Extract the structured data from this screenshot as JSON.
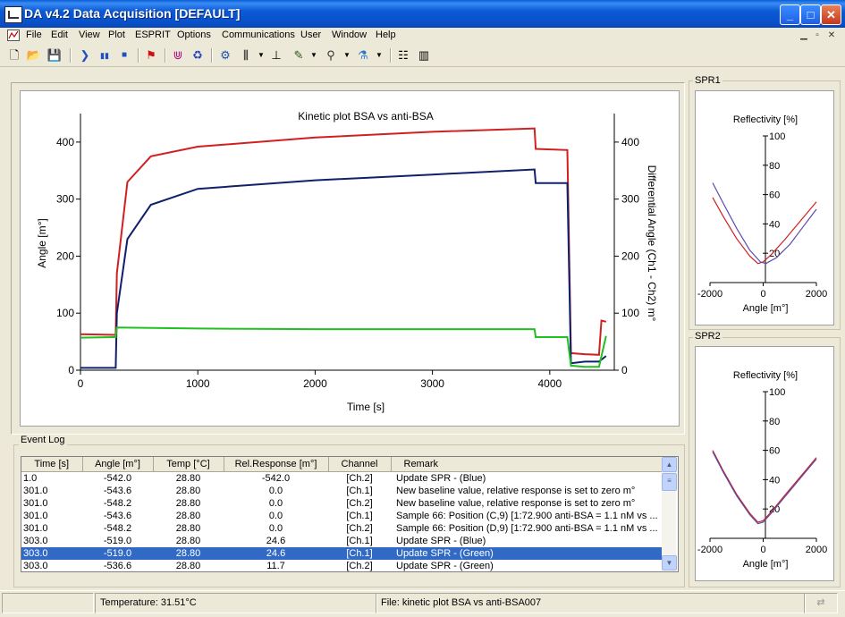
{
  "window": {
    "title": "DA v4.2 Data Acquisition [DEFAULT]",
    "min_label": "_",
    "max_label": "□",
    "close_label": "✕"
  },
  "menu": [
    "File",
    "Edit",
    "View",
    "Plot",
    "ESPRIT",
    "Options",
    "Communications",
    "User",
    "Window",
    "Help"
  ],
  "toolbar_icons": [
    "new-file-icon",
    "open-folder-icon",
    "save-icon",
    "play-icon",
    "pause-icon",
    "stop-icon",
    "flag-icon",
    "spectrum-icon",
    "recycle-icon",
    "settings-icon",
    "tubes-icon",
    "injector-icon",
    "pipette-icon",
    "tap-icon",
    "flask-icon",
    "layout-icon",
    "bars-icon"
  ],
  "main_plot": {
    "title": "Kinetic plot BSA vs anti-BSA",
    "xlabel": "Time [s]",
    "ylabel": "Angle [m°]",
    "y2label": "Differential Angle (Ch1 - Ch2) m°"
  },
  "chart_data": [
    {
      "type": "line",
      "title": "Kinetic plot BSA vs anti-BSA",
      "xlabel": "Time [s]",
      "ylabel": "Angle [m°]",
      "y2label": "Differential Angle (Ch1 - Ch2) m°",
      "xlim": [
        0,
        4550
      ],
      "ylim": [
        0,
        450
      ],
      "y2lim": [
        0,
        450
      ],
      "xticks": [
        0,
        1000,
        2000,
        3000,
        4000
      ],
      "yticks": [
        0,
        100,
        200,
        300,
        400
      ],
      "series": [
        {
          "color": "#d02020",
          "x": [
            0,
            300,
            310,
            400,
            600,
            1000,
            2000,
            3000,
            3870,
            3880,
            4150,
            4180,
            4300,
            4420,
            4440,
            4480
          ],
          "y": [
            63,
            62,
            170,
            330,
            375,
            392,
            408,
            418,
            424,
            388,
            386,
            30,
            28,
            27,
            87,
            85
          ]
        },
        {
          "color": "#10206a",
          "x": [
            0,
            300,
            310,
            400,
            600,
            1000,
            2000,
            3000,
            3870,
            3880,
            4150,
            4180,
            4300,
            4420,
            4480
          ],
          "y": [
            4,
            4,
            100,
            230,
            290,
            318,
            333,
            343,
            352,
            328,
            328,
            12,
            15,
            15,
            25
          ]
        },
        {
          "color": "#20c020",
          "x": [
            0,
            300,
            310,
            1000,
            2000,
            3000,
            3870,
            3880,
            4150,
            4180,
            4300,
            4420,
            4480
          ],
          "y": [
            57,
            58,
            75,
            73,
            72,
            72,
            72,
            58,
            58,
            8,
            6,
            6,
            60
          ]
        }
      ]
    },
    {
      "type": "line",
      "title": "Reflectivity [%]",
      "xlabel": "Angle [m°]",
      "xlim": [
        -2000,
        2000
      ],
      "ylim": [
        0,
        100
      ],
      "xticks": [
        -2000,
        0,
        2000
      ],
      "yticks": [
        20,
        40,
        60,
        80,
        100
      ],
      "series": [
        {
          "color": "#d02020",
          "x": [
            -1900,
            -1500,
            -1000,
            -500,
            -200,
            0,
            300,
            800,
            1400,
            2000
          ],
          "y": [
            58,
            45,
            30,
            18,
            13,
            14,
            19,
            29,
            42,
            55
          ]
        },
        {
          "color": "#5a4ab0",
          "x": [
            -1900,
            -1500,
            -1000,
            -500,
            -100,
            100,
            500,
            1000,
            1500,
            2000
          ],
          "y": [
            68,
            54,
            37,
            22,
            14,
            13,
            17,
            26,
            38,
            50
          ]
        }
      ]
    },
    {
      "type": "line",
      "title": "Reflectivity [%]",
      "xlabel": "Angle [m°]",
      "xlim": [
        -2000,
        2000
      ],
      "ylim": [
        0,
        100
      ],
      "xticks": [
        -2000,
        0,
        2000
      ],
      "yticks": [
        20,
        40,
        60,
        80,
        100
      ],
      "series": [
        {
          "color": "#d02020",
          "x": [
            -1900,
            -1500,
            -1000,
            -500,
            -200,
            0,
            300,
            800,
            1400,
            2000
          ],
          "y": [
            60,
            46,
            30,
            17,
            11,
            12,
            18,
            29,
            42,
            55
          ]
        },
        {
          "color": "#5a4ab0",
          "x": [
            -1900,
            -1500,
            -1000,
            -500,
            -200,
            0,
            300,
            800,
            1400,
            2000
          ],
          "y": [
            59,
            45,
            29,
            16,
            10,
            11,
            17,
            28,
            41,
            54
          ]
        }
      ]
    }
  ],
  "spr1": {
    "label": "SPR1"
  },
  "spr2": {
    "label": "SPR2"
  },
  "event_log": {
    "label": "Event Log",
    "columns": [
      "Time [s]",
      "Angle [m°]",
      "Temp [°C]",
      "Rel.Response [m°]",
      "Channel",
      "Remark"
    ],
    "rows": [
      [
        "1.0",
        "-542.0",
        "28.80",
        "-542.0",
        "[Ch.2]",
        "Update SPR - (Blue)"
      ],
      [
        "301.0",
        "-543.6",
        "28.80",
        "0.0",
        "[Ch.1]",
        "New baseline value, relative response is set to zero m°"
      ],
      [
        "301.0",
        "-548.2",
        "28.80",
        "0.0",
        "[Ch.2]",
        "New baseline value, relative response is set to zero m°"
      ],
      [
        "301.0",
        "-543.6",
        "28.80",
        "0.0",
        "[Ch.1]",
        "Sample 66:  Position (C,9)  [1:72.900 anti-BSA =  1.1 nM  vs ..."
      ],
      [
        "301.0",
        "-548.2",
        "28.80",
        "0.0",
        "[Ch.2]",
        "Sample 66:  Position (D,9)  [1:72.900 anti-BSA =  1.1 nM  vs ..."
      ],
      [
        "303.0",
        "-519.0",
        "28.80",
        "24.6",
        "[Ch.1]",
        "Update SPR - (Blue)"
      ],
      [
        "303.0",
        "-519.0",
        "28.80",
        "24.6",
        "[Ch.1]",
        "Update SPR - (Green)"
      ],
      [
        "303.0",
        "-536.6",
        "28.80",
        "11.7",
        "[Ch.2]",
        "Update SPR - (Green)"
      ]
    ],
    "selected_row": 6
  },
  "status": {
    "temperature": "Temperature: 31.51°C",
    "file": "File: kinetic plot BSA vs anti-BSA007"
  }
}
